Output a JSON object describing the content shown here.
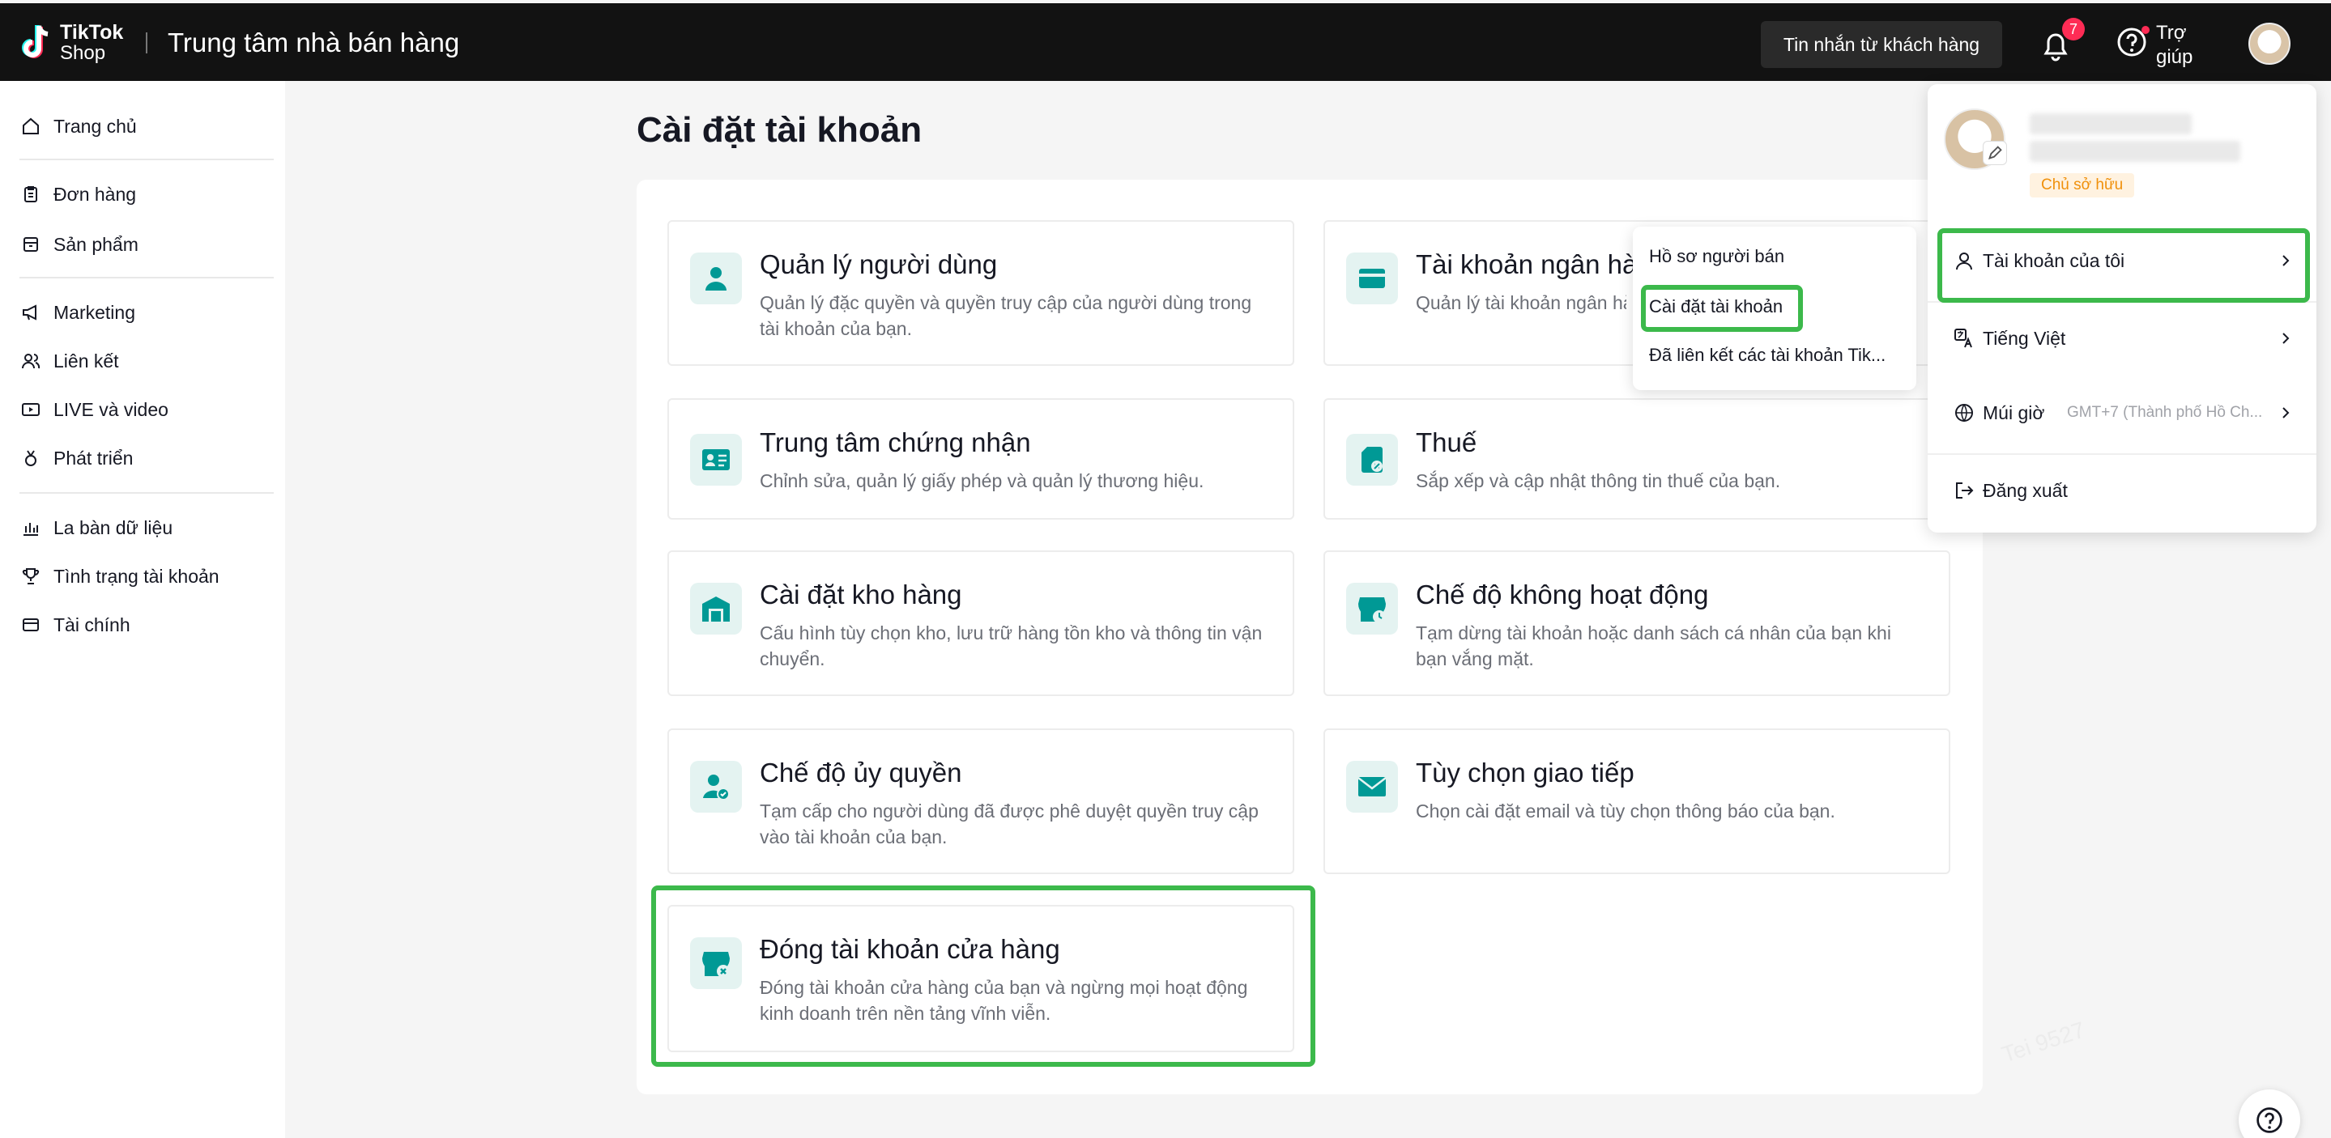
{
  "header": {
    "brand_top": "TikTok",
    "brand_bottom": "Shop",
    "title": "Trung tâm nhà bán hàng",
    "messages_button": "Tin nhắn từ khách hàng",
    "notification_count": "7",
    "help_label": "Trợ giúp"
  },
  "sidebar": {
    "items": [
      {
        "label": "Trang chủ",
        "icon": "home-icon"
      },
      {
        "label": "Đơn hàng",
        "icon": "clipboard-icon"
      },
      {
        "label": "Sản phẩm",
        "icon": "box-icon"
      },
      {
        "label": "Marketing",
        "icon": "megaphone-icon"
      },
      {
        "label": "Liên kết",
        "icon": "people-icon"
      },
      {
        "label": "LIVE và video",
        "icon": "video-icon"
      },
      {
        "label": "Phát triển",
        "icon": "medal-icon"
      },
      {
        "label": "La bàn dữ liệu",
        "icon": "chart-icon"
      },
      {
        "label": "Tình trạng tài khoản",
        "icon": "trophy-icon"
      },
      {
        "label": "Tài chính",
        "icon": "wallet-icon"
      }
    ]
  },
  "main": {
    "title": "Cài đặt tài khoản",
    "cards": [
      {
        "title": "Quản lý người dùng",
        "desc": "Quản lý đặc quyền và quyền truy cập của người dùng trong tài khoản của bạn."
      },
      {
        "title": "Tài khoản ngân hà",
        "desc": "Quản lý tài khoản ngân hà"
      },
      {
        "title": "Trung tâm chứng nhận",
        "desc": "Chỉnh sửa, quản lý giấy phép và quản lý thương hiệu."
      },
      {
        "title": "Thuế",
        "desc": "Sắp xếp và cập nhật thông tin thuế của bạn."
      },
      {
        "title": "Cài đặt kho hàng",
        "desc": "Cấu hình tùy chọn kho, lưu trữ hàng tồn kho và thông tin vận chuyển."
      },
      {
        "title": "Chế độ không hoạt động",
        "desc": "Tạm dừng tài khoản hoặc danh sách cá nhân của bạn khi bạn vắng mặt."
      },
      {
        "title": "Chế độ ủy quyền",
        "desc": "Tạm cấp cho người dùng đã được phê duyệt quyền truy cập vào tài khoản của bạn."
      },
      {
        "title": "Tùy chọn giao tiếp",
        "desc": "Chọn cài đặt email và tùy chọn thông báo của bạn."
      },
      {
        "title": "Đóng tài khoản cửa hàng",
        "desc": "Đóng tài khoản cửa hàng của bạn và ngừng mọi hoạt động kinh doanh trên nền tảng vĩnh viễn."
      }
    ]
  },
  "submenu": {
    "items": [
      "Hồ sơ người bán",
      "Cài đặt tài khoản",
      "Đã liên kết các tài khoản Tik..."
    ]
  },
  "account_menu": {
    "role": "Chủ sở hữu",
    "my_account": "Tài khoản của tôi",
    "language": "Tiếng Việt",
    "timezone_label": "Múi giờ",
    "timezone_value": "GMT+7 (Thành phố Hồ Ch...",
    "logout": "Đăng xuất"
  },
  "watermark": "Tei 9527",
  "colors": {
    "accent": "#009995",
    "highlight": "#3cb94b",
    "badge": "#fe2c55",
    "owner": "#f0900a"
  }
}
